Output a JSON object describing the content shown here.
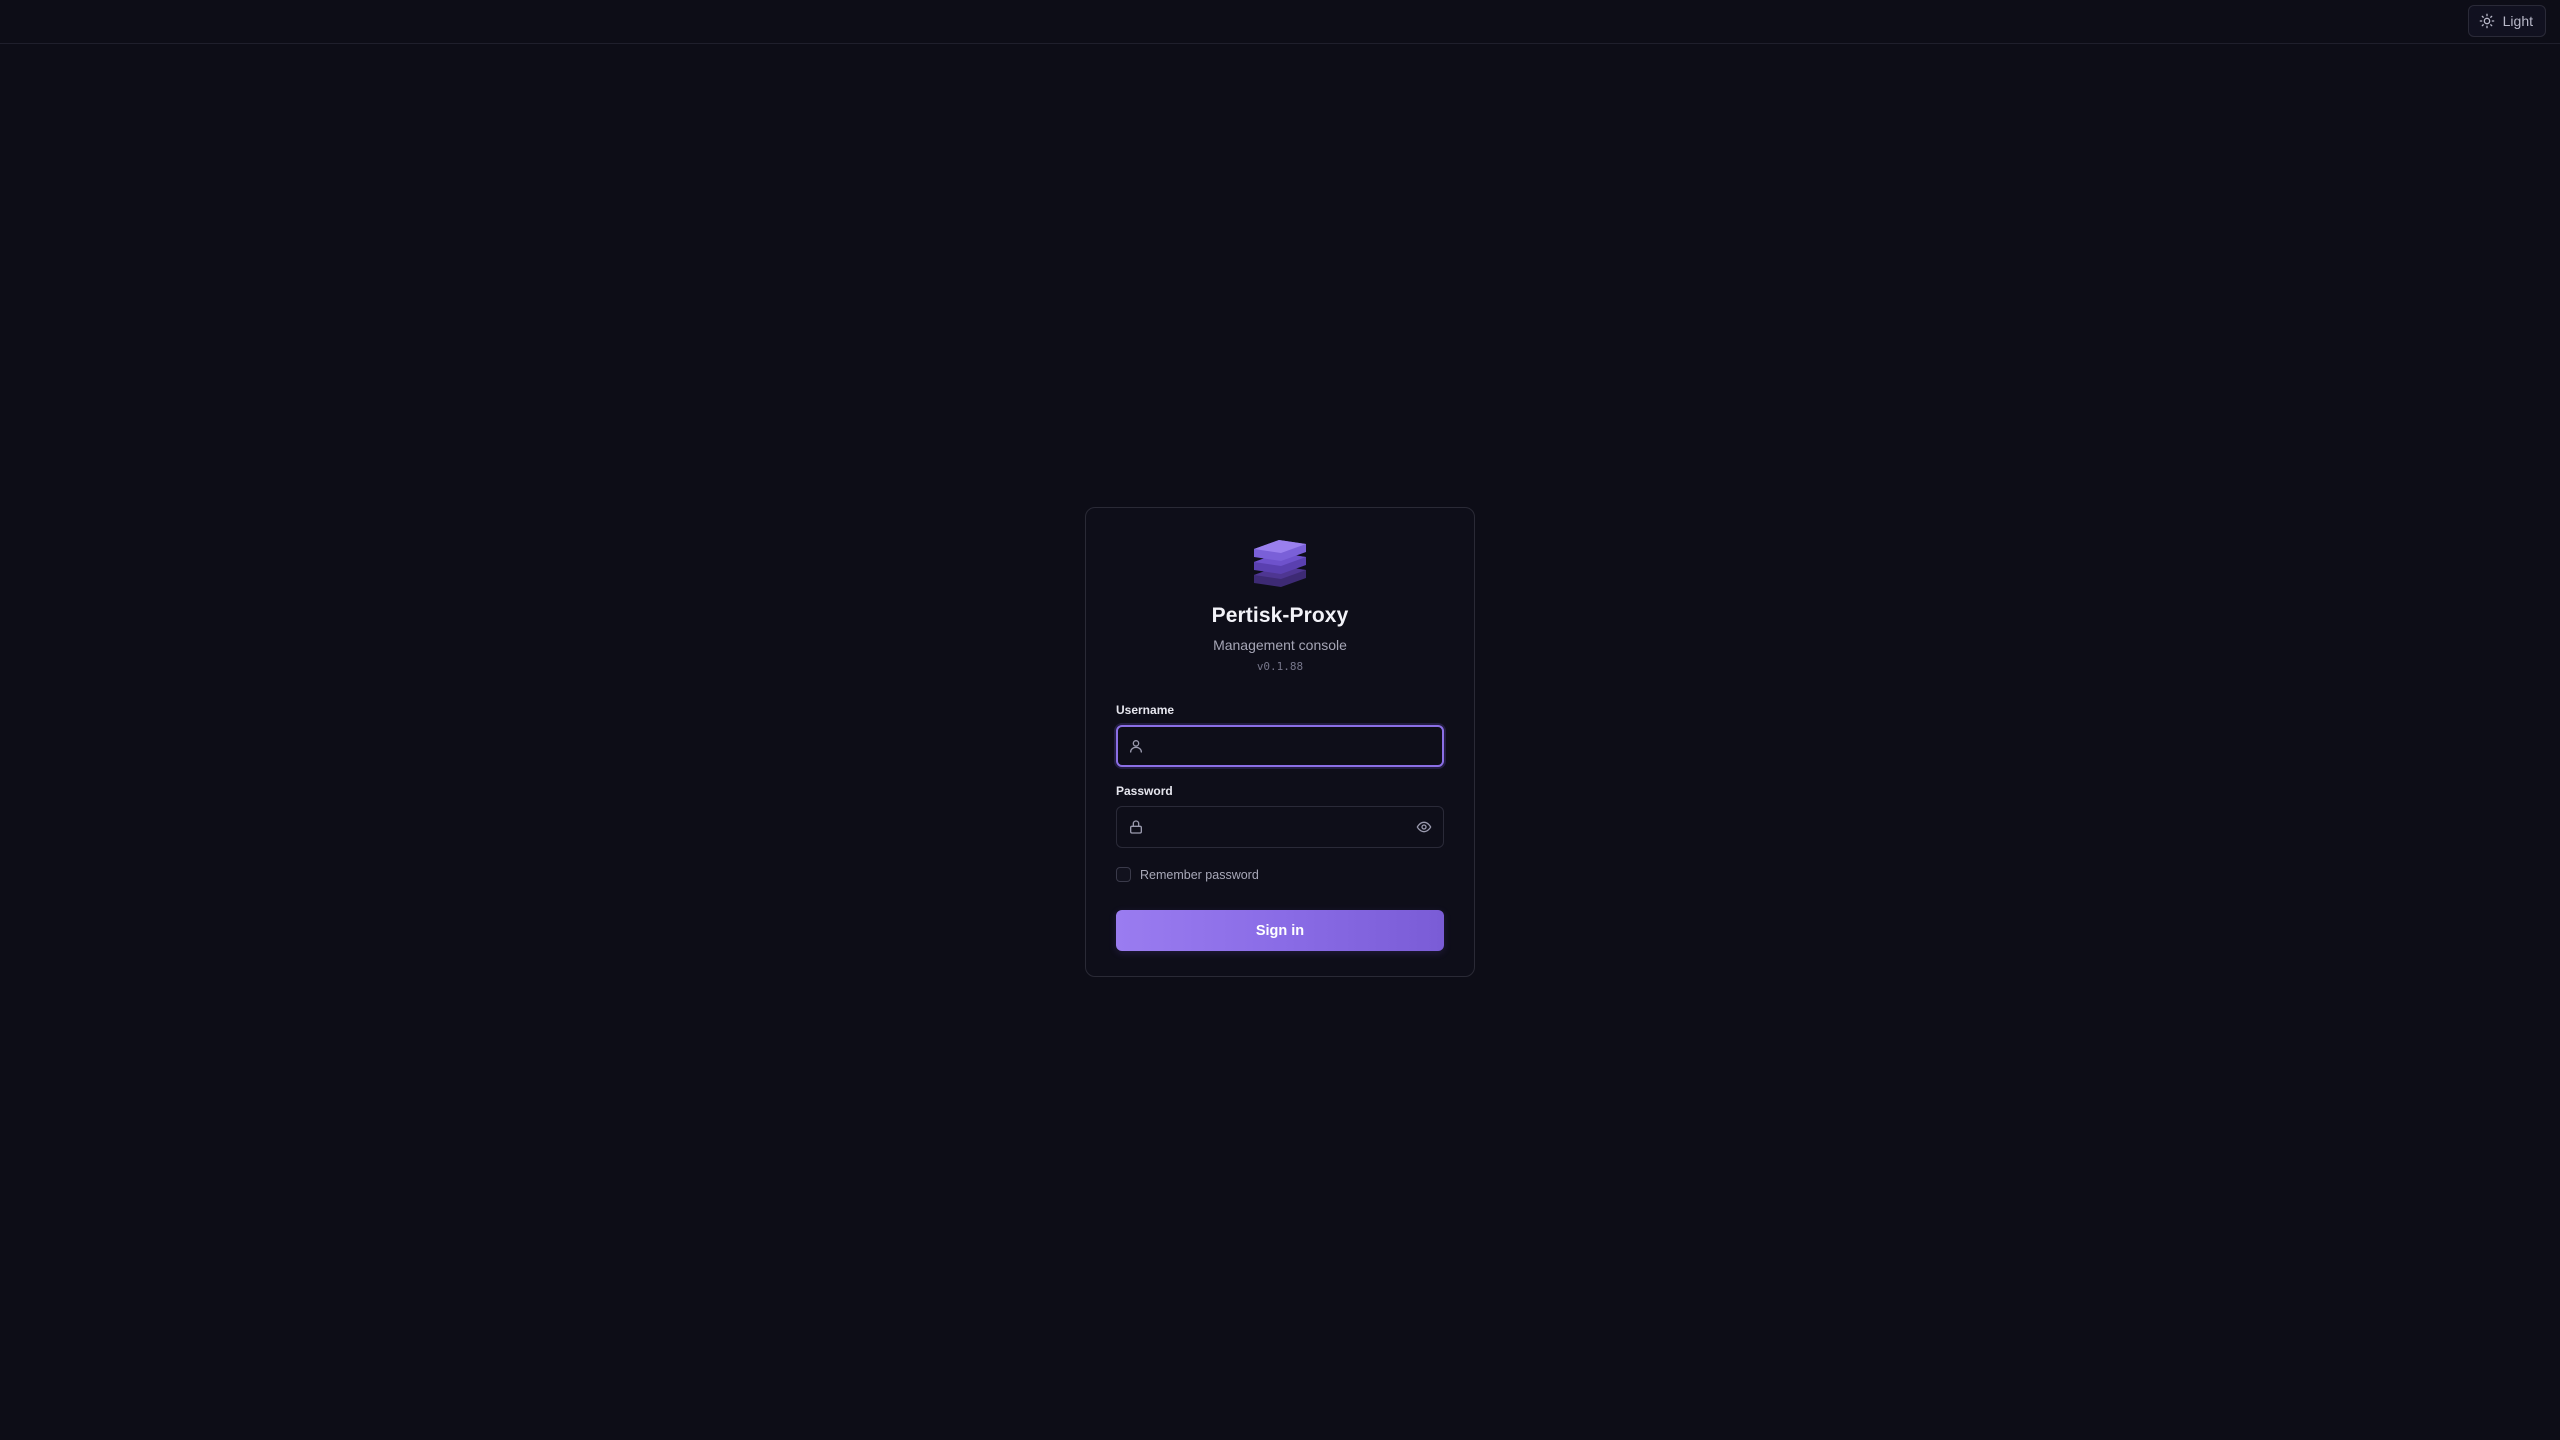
{
  "header": {
    "theme_toggle": {
      "label": "Light",
      "icon": "sun-icon"
    }
  },
  "login": {
    "logo_icon": "stacked-layers-logo",
    "title": "Pertisk-Proxy",
    "subtitle": "Management console",
    "version": "v0.1.88",
    "username": {
      "label": "Username",
      "value": "",
      "placeholder": "",
      "icon": "user-icon",
      "focused": true
    },
    "password": {
      "label": "Password",
      "value": "",
      "placeholder": "",
      "icon": "lock-icon",
      "toggle_icon": "eye-icon"
    },
    "remember": {
      "label": "Remember password",
      "checked": false
    },
    "submit_label": "Sign in"
  },
  "colors": {
    "background": "#0d0d17",
    "card_background": "#0e0e19",
    "accent": "#8b6fe6",
    "button_gradient_start": "#9a7cf0",
    "button_gradient_end": "#7a5cd6",
    "text_primary": "#f2f2f8",
    "text_muted": "#a6a6b6"
  }
}
